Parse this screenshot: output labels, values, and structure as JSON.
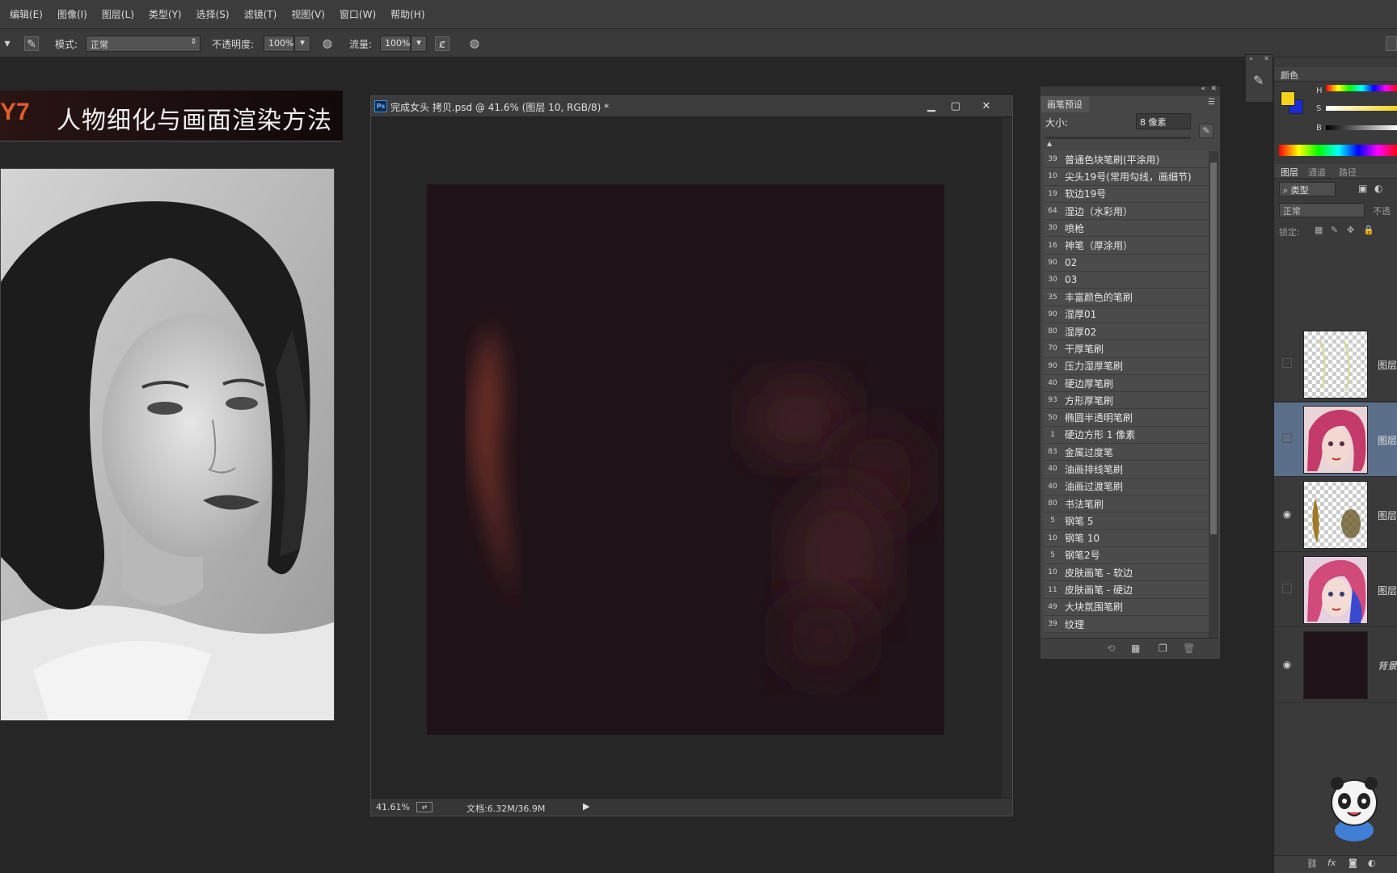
{
  "menu": [
    "编辑(E)",
    "图像(I)",
    "图层(L)",
    "类型(Y)",
    "选择(S)",
    "滤镜(T)",
    "视图(V)",
    "窗口(W)",
    "帮助(H)"
  ],
  "options": {
    "mode_label": "模式:",
    "mode_value": "正常",
    "opacity_label": "不透明度:",
    "opacity_value": "100%",
    "flow_label": "流量:",
    "flow_value": "100%"
  },
  "banner": {
    "code": "Y7",
    "title": "人物细化与画面渲染方法"
  },
  "document": {
    "title": "完成女头 拷贝.psd @ 41.6% (图层 10, RGB/8) *",
    "zoom": "41.61%",
    "doc_info": "文档:6.32M/36.9M"
  },
  "brush_panel": {
    "tab": "画笔预设",
    "size_label": "大小:",
    "size_value": "8 像素",
    "brushes": [
      {
        "size": "39",
        "name": "普通色块笔刷(平涂用)"
      },
      {
        "size": "10",
        "name": "尖头19号(常用勾线，画细节)"
      },
      {
        "size": "19",
        "name": "软边19号"
      },
      {
        "size": "64",
        "name": "湿边（水彩用）"
      },
      {
        "size": "30",
        "name": "喷枪"
      },
      {
        "size": "16",
        "name": "神笔（厚涂用）"
      },
      {
        "size": "90",
        "name": "02"
      },
      {
        "size": "30",
        "name": "03"
      },
      {
        "size": "35",
        "name": "丰富颜色的笔刷"
      },
      {
        "size": "90",
        "name": "湿厚01"
      },
      {
        "size": "80",
        "name": "湿厚02"
      },
      {
        "size": "70",
        "name": "干厚笔刷"
      },
      {
        "size": "90",
        "name": "压力湿厚笔刷"
      },
      {
        "size": "40",
        "name": "硬边厚笔刷"
      },
      {
        "size": "93",
        "name": "方形厚笔刷"
      },
      {
        "size": "50",
        "name": "椭圆半透明笔刷"
      },
      {
        "size": "1",
        "name": "硬边方形 1 像素"
      },
      {
        "size": "83",
        "name": "金属过度笔"
      },
      {
        "size": "40",
        "name": "油画排线笔刷"
      },
      {
        "size": "40",
        "name": "油画过渡笔刷"
      },
      {
        "size": "80",
        "name": "书法笔刷"
      },
      {
        "size": "5",
        "name": "钢笔 5"
      },
      {
        "size": "10",
        "name": "钢笔 10"
      },
      {
        "size": "5",
        "name": "钢笔2号"
      },
      {
        "size": "10",
        "name": "皮肤画笔 - 软边"
      },
      {
        "size": "11",
        "name": "皮肤画笔 - 硬边"
      },
      {
        "size": "49",
        "name": "大块氛围笔刷"
      },
      {
        "size": "39",
        "name": "纹理"
      }
    ]
  },
  "color_panel": {
    "tab": "颜色",
    "channels": [
      "H",
      "S",
      "B"
    ],
    "fg_color": "#f5d21e",
    "bg_color": "#1a2bd6"
  },
  "layers_panel": {
    "tabs": [
      "图层",
      "通道",
      "路径"
    ],
    "filter": "类型",
    "blend_mode": "正常",
    "opacity_abbrev": "不透",
    "lock_label": "锁定:",
    "layers": [
      {
        "name": "图层",
        "visible": false,
        "thumb": "sketch"
      },
      {
        "name": "图层",
        "visible": false,
        "thumb": "portrait",
        "selected": true
      },
      {
        "name": "图层",
        "visible": true,
        "thumb": "strokes"
      },
      {
        "name": "图层",
        "visible": false,
        "thumb": "portrait2"
      },
      {
        "name": "背景",
        "visible": true,
        "thumb": "dark"
      }
    ]
  }
}
